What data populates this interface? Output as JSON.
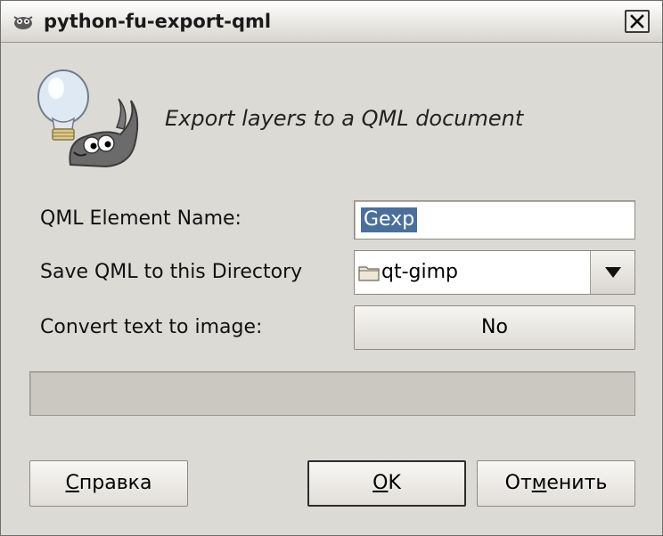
{
  "window": {
    "title": "python-fu-export-qml"
  },
  "dialog": {
    "heading": "Export layers to a QML document"
  },
  "fields": {
    "element_name_label": "QML Element Name:",
    "element_name_value": "Gexp",
    "directory_label": "Save QML to this Directory",
    "directory_value": "qt-gimp",
    "convert_label": "Convert text to image:",
    "convert_value": "No"
  },
  "progress": {
    "value": 0
  },
  "buttons": {
    "help_first": "С",
    "help_rest": "правка",
    "ok_first": "O",
    "ok_rest": "K",
    "cancel_pre": "От",
    "cancel_u": "м",
    "cancel_post": "енить"
  },
  "icons": {
    "app": "gimp-icon",
    "close": "close-icon",
    "mascot": "wilber-lightbulb-icon",
    "folder": "folder-icon",
    "dropdown": "chevron-down-icon"
  }
}
